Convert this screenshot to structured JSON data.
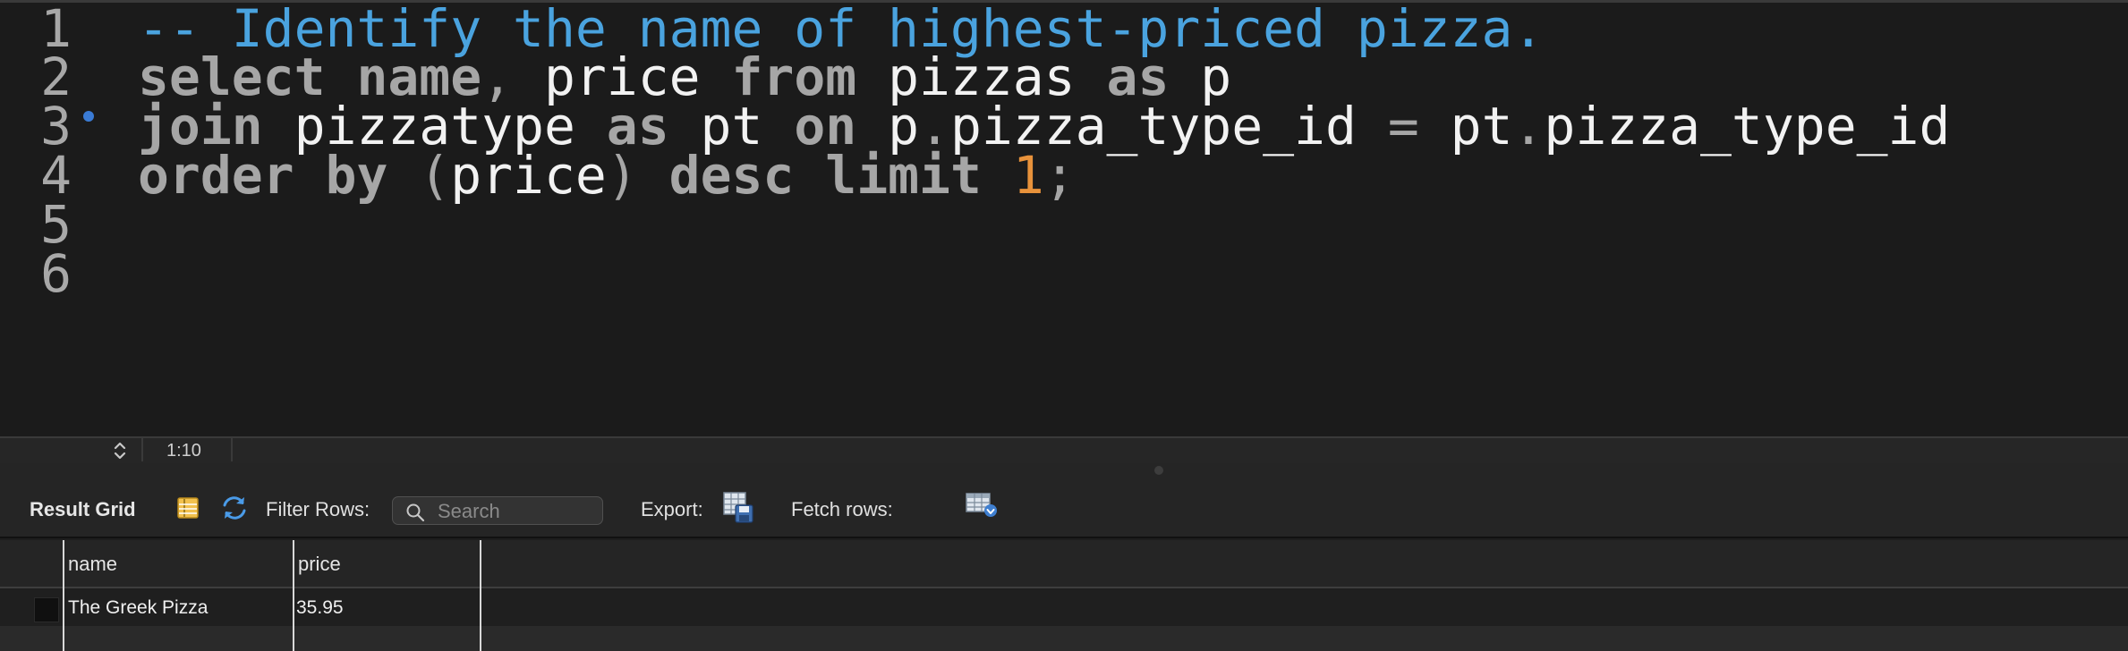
{
  "editor": {
    "line_numbers": [
      "1",
      "2",
      "3",
      "4",
      "5",
      "6"
    ],
    "lines": [
      [
        {
          "t": "-- Identify the name of highest-priced pizza.",
          "c": "comment"
        }
      ],
      [
        {
          "t": "select",
          "c": "kw"
        },
        {
          "t": " ",
          "c": "id"
        },
        {
          "t": "name",
          "c": "kw"
        },
        {
          "t": ",",
          "c": "punc"
        },
        {
          "t": " price ",
          "c": "id"
        },
        {
          "t": "from",
          "c": "kw"
        },
        {
          "t": " pizzas ",
          "c": "id"
        },
        {
          "t": "as",
          "c": "kw"
        },
        {
          "t": " p",
          "c": "id"
        }
      ],
      [
        {
          "t": "join",
          "c": "kw"
        },
        {
          "t": " pizzatype ",
          "c": "id"
        },
        {
          "t": "as",
          "c": "kw"
        },
        {
          "t": " pt ",
          "c": "id"
        },
        {
          "t": "on",
          "c": "kw"
        },
        {
          "t": " p",
          "c": "id"
        },
        {
          "t": ".",
          "c": "punc"
        },
        {
          "t": "pizza_type_id ",
          "c": "id"
        },
        {
          "t": "=",
          "c": "punc"
        },
        {
          "t": " pt",
          "c": "id"
        },
        {
          "t": ".",
          "c": "punc"
        },
        {
          "t": "pizza_type_id",
          "c": "id"
        }
      ],
      [
        {
          "t": "order",
          "c": "kw"
        },
        {
          "t": " ",
          "c": "id"
        },
        {
          "t": "by",
          "c": "kw"
        },
        {
          "t": " ",
          "c": "id"
        },
        {
          "t": "(",
          "c": "punc"
        },
        {
          "t": "price",
          "c": "id"
        },
        {
          "t": ")",
          "c": "punc"
        },
        {
          "t": " ",
          "c": "id"
        },
        {
          "t": "desc",
          "c": "kw"
        },
        {
          "t": " ",
          "c": "id"
        },
        {
          "t": "limit",
          "c": "kw"
        },
        {
          "t": " ",
          "c": "id"
        },
        {
          "t": "1",
          "c": "num"
        },
        {
          "t": ";",
          "c": "punc"
        }
      ],
      [],
      []
    ]
  },
  "status": {
    "cursor_position": "1:10"
  },
  "results": {
    "title": "Result Grid",
    "filter_label": "Filter Rows:",
    "search_placeholder": "Search",
    "export_label": "Export:",
    "fetch_label": "Fetch rows:",
    "columns": [
      "name",
      "price"
    ],
    "rows": [
      [
        "The Greek Pizza",
        "35.95"
      ]
    ]
  },
  "icons": {
    "updown": "chevron-updown-icon",
    "grid_form": "form-editor-icon",
    "refresh": "refresh-icon",
    "search": "search-icon",
    "export": "export-icon",
    "fetch": "fetch-rows-icon"
  },
  "colors": {
    "comment": "#4aa3df",
    "keyword": "#a6a6a6",
    "identifier": "#f2f2f2",
    "number": "#e8923b",
    "background": "#1b1b1b"
  }
}
